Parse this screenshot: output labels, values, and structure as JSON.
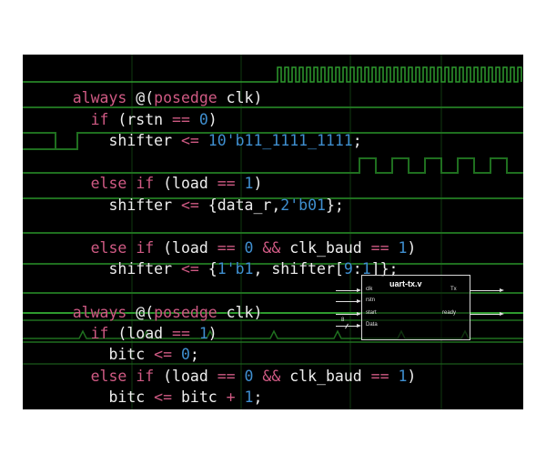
{
  "code": {
    "block1": {
      "l1": {
        "kw1": "always",
        "p1": " @(",
        "kw2": "posedge",
        "p2": " clk)"
      },
      "l2": {
        "indent": "  ",
        "kw": "if",
        "t1": " (rstn ",
        "op": "==",
        "t2": " ",
        "n": "0",
        "t3": ")"
      },
      "l3": {
        "indent": "    ",
        "t1": "shifter ",
        "op": "<=",
        "t2": " ",
        "n": "10'b11_1111_1111",
        "t3": ";"
      },
      "l4": {
        "indent": "  ",
        "kw1": "else",
        "t0": " ",
        "kw2": "if",
        "t1": " (load ",
        "op": "==",
        "t2": " ",
        "n": "1",
        "t3": ")"
      },
      "l5": {
        "indent": "    ",
        "t1": "shifter ",
        "op": "<=",
        "t2": " {data_r,",
        "n": "2'b01",
        "t3": "};"
      },
      "l6": {
        "indent": "  ",
        "kw1": "else",
        "t0": " ",
        "kw2": "if",
        "t1": " (load ",
        "op1": "==",
        "t2": " ",
        "n1": "0",
        "t3": " ",
        "op2": "&&",
        "t4": " clk_baud ",
        "op3": "==",
        "t5": " ",
        "n2": "1",
        "t6": ")"
      },
      "l7": {
        "indent": "    ",
        "t1": "shifter ",
        "op": "<=",
        "t2": " {",
        "n1": "1'b1",
        "t3": ", shifter[",
        "n2": "9",
        "t4": ":",
        "n3": "1",
        "t5": "]};"
      }
    },
    "block2": {
      "l1": {
        "kw1": "always",
        "p1": " @(",
        "kw2": "posedge",
        "p2": " clk)"
      },
      "l2": {
        "indent": "  ",
        "kw": "if",
        "t1": " (load ",
        "op": "==",
        "t2": " ",
        "n": "1",
        "t3": ")"
      },
      "l3": {
        "indent": "    ",
        "t1": "bitc ",
        "op": "<=",
        "t2": " ",
        "n": "0",
        "t3": ";"
      },
      "l4": {
        "indent": "  ",
        "kw1": "else",
        "t0": " ",
        "kw2": "if",
        "t1": " (load ",
        "op1": "==",
        "t2": " ",
        "n1": "0",
        "t3": " ",
        "op2": "&&",
        "t4": " clk_baud ",
        "op3": "==",
        "t5": " ",
        "n2": "1",
        "t6": ")"
      },
      "l5": {
        "indent": "    ",
        "t1": "bitc ",
        "op1": "<=",
        "t2": " bitc ",
        "op2": "+",
        "t3": " ",
        "n": "1",
        "t4": ";"
      }
    }
  },
  "diagram": {
    "title": "uart-tx.v",
    "inputs": [
      "clk",
      "rstn",
      "start",
      "Data"
    ],
    "outputs": [
      "Tx",
      "ready"
    ],
    "bus_width": "8"
  },
  "colors": {
    "keyword": "#d05a84",
    "number": "#3f8fd0",
    "text": "#eeeeee",
    "wave": "#1f6f1f",
    "wave_bright": "#2e9a2e",
    "background": "#000000"
  }
}
